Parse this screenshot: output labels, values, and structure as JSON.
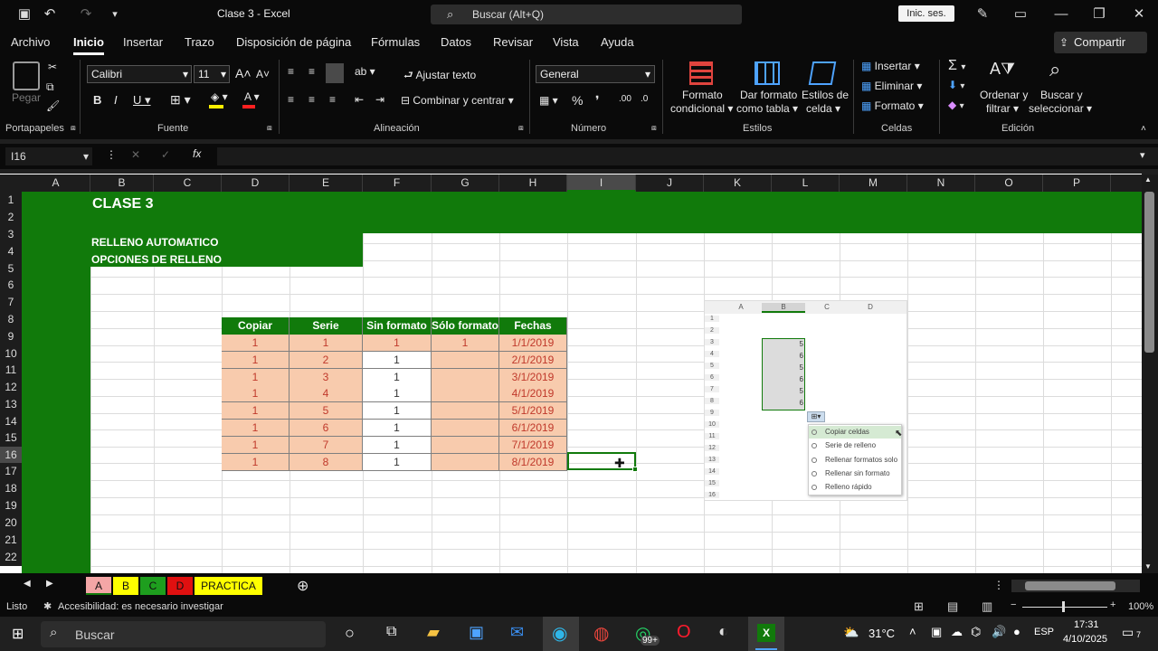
{
  "window": {
    "title": "Clase 3  -  Excel",
    "search_placeholder": "Buscar (Alt+Q)",
    "signin": "Inic. ses."
  },
  "menu": [
    "Archivo",
    "Inicio",
    "Insertar",
    "Trazo",
    "Disposición de página",
    "Fórmulas",
    "Datos",
    "Revisar",
    "Vista",
    "Ayuda"
  ],
  "share": "Compartir",
  "ribbon": {
    "paste": "Pegar",
    "font_name": "Calibri",
    "font_size": "11",
    "wrap_text": "Ajustar texto",
    "merge_center": "Combinar y centrar",
    "number_format": "General",
    "conditional_1": "Formato",
    "conditional_2": "condicional",
    "table_1": "Dar formato",
    "table_2": "como tabla",
    "styles_1": "Estilos de",
    "styles_2": "celda",
    "insert": "Insertar",
    "delete": "Eliminar",
    "format": "Formato",
    "sort_1": "Ordenar y",
    "sort_2": "filtrar",
    "find_1": "Buscar y",
    "find_2": "seleccionar",
    "groups": [
      "Portapapeles",
      "Fuente",
      "Alineación",
      "Número",
      "Estilos",
      "Celdas",
      "Edición"
    ]
  },
  "namebox": "I16",
  "columns": [
    "A",
    "B",
    "C",
    "D",
    "E",
    "F",
    "G",
    "H",
    "I",
    "J",
    "K",
    "L",
    "M",
    "N",
    "O",
    "P"
  ],
  "rows": [
    "1",
    "2",
    "3",
    "4",
    "5",
    "6",
    "7",
    "8",
    "9",
    "10",
    "11",
    "12",
    "13",
    "14",
    "15",
    "16",
    "17",
    "18",
    "19",
    "20",
    "21",
    "22"
  ],
  "cells": {
    "title": "CLASE 3",
    "line1": "RELLENO AUTOMATICO",
    "line2": "OPCIONES DE RELLENO"
  },
  "table": {
    "headers": [
      "Copiar",
      "Serie",
      "Sin formato",
      "Sólo formato",
      "Fechas"
    ],
    "rows": [
      [
        "1",
        "1",
        "1",
        "1",
        "1/1/2019"
      ],
      [
        "1",
        "2",
        "1",
        "",
        "2/1/2019"
      ],
      [
        "1",
        "3",
        "1",
        "",
        "3/1/2019"
      ],
      [
        "1",
        "4",
        "1",
        "",
        "4/1/2019"
      ],
      [
        "1",
        "5",
        "1",
        "",
        "5/1/2019"
      ],
      [
        "1",
        "6",
        "1",
        "",
        "6/1/2019"
      ],
      [
        "1",
        "7",
        "1",
        "",
        "7/1/2019"
      ],
      [
        "1",
        "8",
        "1",
        "",
        "8/1/2019"
      ]
    ]
  },
  "inset": {
    "cols": [
      "A",
      "B",
      "C",
      "D"
    ],
    "rows": [
      "1",
      "2",
      "3",
      "4",
      "5",
      "6",
      "7",
      "8",
      "9",
      "10",
      "11",
      "12",
      "13",
      "14",
      "15",
      "16"
    ],
    "values": [
      "5",
      "6",
      "5",
      "6",
      "5",
      "6"
    ],
    "options": [
      "Copiar celdas",
      "Serie de relleno",
      "Rellenar formatos solo",
      "Rellenar sin formato",
      "Relleno rápido"
    ]
  },
  "sheet_tabs": [
    {
      "label": "A",
      "color": "#f4a6a6"
    },
    {
      "label": "B",
      "color": "#ffff00"
    },
    {
      "label": "C",
      "color": "#1e9e1e"
    },
    {
      "label": "D",
      "color": "#e01010"
    },
    {
      "label": "PRACTICA",
      "color": "#ffff00"
    }
  ],
  "status": {
    "ready": "Listo",
    "accessibility": "Accesibilidad: es necesario investigar",
    "zoom": "100%"
  },
  "taskbar": {
    "search": "Buscar",
    "temp": "31°C",
    "lang": "ESP",
    "time": "17:31",
    "date": "4/10/2025",
    "badge": "99+",
    "notif": "7"
  }
}
